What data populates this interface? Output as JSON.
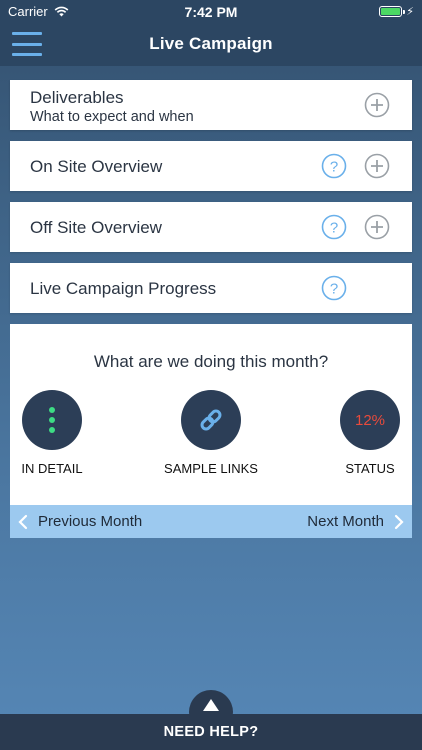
{
  "status_bar": {
    "carrier": "Carrier",
    "time": "7:42 PM",
    "battery_icon": "battery-full-icon"
  },
  "nav": {
    "title": "Live Campaign",
    "menu_icon": "hamburger-menu-icon"
  },
  "cards": [
    {
      "title": "Deliverables",
      "subtitle": "What to expect and when",
      "help": false,
      "expand": true
    },
    {
      "title": "On Site Overview",
      "help": true,
      "expand": true
    },
    {
      "title": "Off Site Overview",
      "help": true,
      "expand": true
    },
    {
      "title": "Live Campaign Progress",
      "help": true,
      "expand": false
    }
  ],
  "month": {
    "question": "What are we doing this month?",
    "actions": [
      {
        "label": "IN DETAIL",
        "icon": "vertical-dots-icon"
      },
      {
        "label": "SAMPLE LINKS",
        "icon": "link-icon"
      },
      {
        "label": "STATUS",
        "value": "12%"
      }
    ],
    "prev_label": "Previous Month",
    "next_label": "Next Month"
  },
  "help": {
    "label": "NEED HELP?"
  },
  "colors": {
    "header": "#2c4662",
    "accent_blue": "#6ab0ea",
    "month_nav_bg": "#9cc9ef",
    "circle_bg": "#2c3e57",
    "status_red": "#e84b3c",
    "dots_green": "#3ddc84",
    "battery_green": "#4cd964"
  }
}
